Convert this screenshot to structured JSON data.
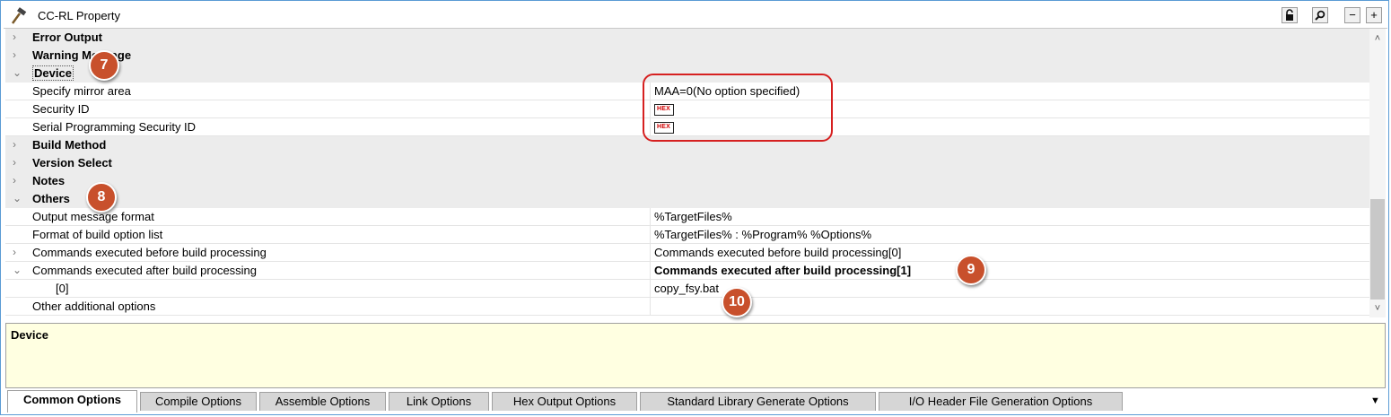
{
  "window": {
    "title": "CC-RL Property",
    "icon": "hammer-icon",
    "buttons": [
      "lock-icon",
      "search-icon",
      "−",
      "+"
    ]
  },
  "property_grid": {
    "rows": [
      {
        "type": "category",
        "expanded": false,
        "name": "Error Output"
      },
      {
        "type": "category",
        "expanded": false,
        "name": "Warning Message"
      },
      {
        "type": "category",
        "expanded": true,
        "name": "Device"
      },
      {
        "type": "property",
        "name": "Specify mirror area",
        "value": "MAA=0(No option specified)"
      },
      {
        "type": "property",
        "name": "Security ID",
        "value_icon": "HEX"
      },
      {
        "type": "property",
        "name": "Serial Programming Security ID",
        "value_icon": "HEX"
      },
      {
        "type": "category",
        "expanded": false,
        "name": "Build Method"
      },
      {
        "type": "category",
        "expanded": false,
        "name": "Version Select"
      },
      {
        "type": "category",
        "expanded": false,
        "name": "Notes"
      },
      {
        "type": "category",
        "expanded": true,
        "name": "Others"
      },
      {
        "type": "property",
        "name": "Output message format",
        "value": "%TargetFiles%"
      },
      {
        "type": "property",
        "name": "Format of build option list",
        "value": "%TargetFiles% : %Program% %Options%"
      },
      {
        "type": "property",
        "expandable": true,
        "expanded": false,
        "name": "Commands executed before build processing",
        "value": "Commands executed before build processing[0]"
      },
      {
        "type": "property",
        "expandable": true,
        "expanded": true,
        "name": "Commands executed after build processing",
        "value": "Commands executed after build processing[1]",
        "bold_value": true
      },
      {
        "type": "subitem",
        "name": "[0]",
        "value": "copy_fsy.bat"
      },
      {
        "type": "property",
        "name": "Other additional options",
        "value": ""
      }
    ]
  },
  "callouts": [
    "7",
    "8",
    "9",
    "10"
  ],
  "description": {
    "title": "Device"
  },
  "tabs": {
    "items": [
      "Common Options",
      "Compile Options",
      "Assemble Options",
      "Link Options",
      "Hex Output Options",
      "Standard Library Generate Options",
      "I/O Header File Generation Options"
    ],
    "active": "Common Options",
    "overflow_icon": "dropdown-arrow-icon"
  },
  "colors": {
    "callout": "#c8502c",
    "highlight_box": "#d62020",
    "category_bg": "#ececec",
    "description_bg": "#ffffe1"
  }
}
